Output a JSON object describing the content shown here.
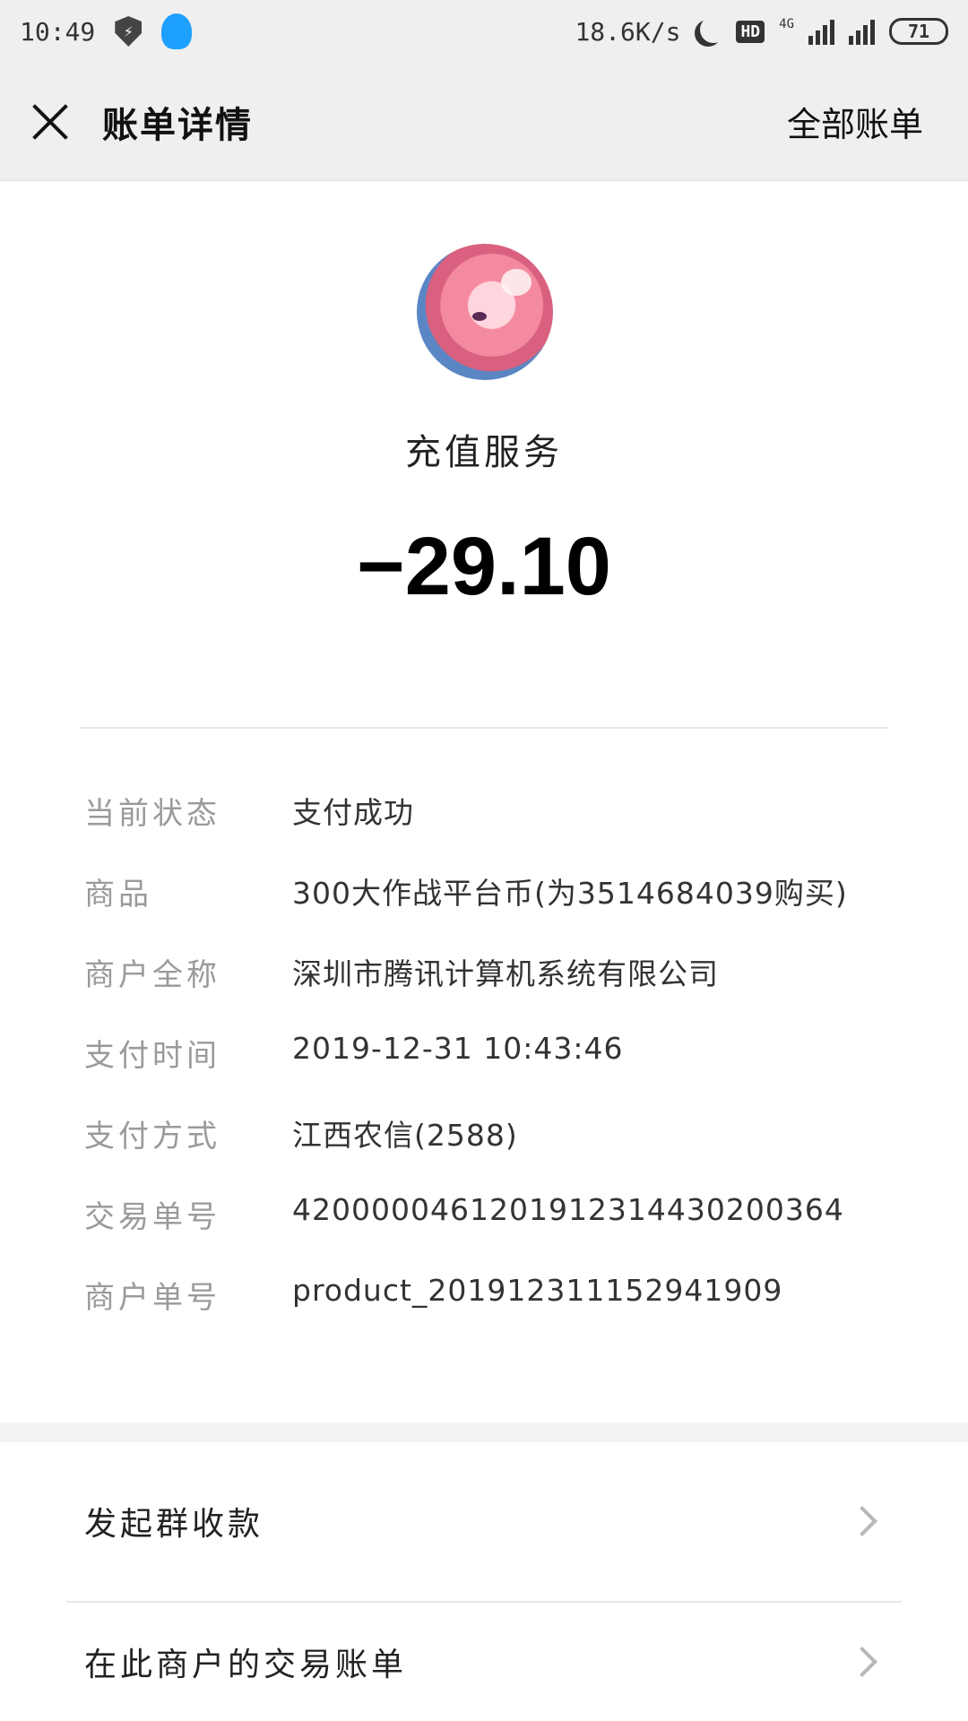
{
  "status_bar": {
    "time": "10:49",
    "network_speed": "18.6K/s",
    "hd_label": "HD",
    "network_type": "4G",
    "battery": "71",
    "icons": [
      "shield-icon",
      "qq-penguin-icon",
      "moon-icon",
      "signal-icon",
      "battery-icon"
    ]
  },
  "header": {
    "title": "账单详情",
    "all_bills_label": "全部账单",
    "close_icon": "close-icon"
  },
  "summary": {
    "merchant_name": "充值服务",
    "amount": "−29.10"
  },
  "details": [
    {
      "label": "当前状态",
      "value": "支付成功"
    },
    {
      "label": "商品",
      "value": "300大作战平台币(为3514684039购买)"
    },
    {
      "label": "商户全称",
      "value": "深圳市腾讯计算机系统有限公司"
    },
    {
      "label": "支付时间",
      "value": "2019-12-31 10:43:46"
    },
    {
      "label": "支付方式",
      "value": "江西农信(2588)"
    },
    {
      "label": "交易单号",
      "value": "4200000461201912314430200364"
    },
    {
      "label": "商户单号",
      "value": "product_201912311152941909"
    }
  ],
  "actions": [
    {
      "label": "发起群收款"
    },
    {
      "label": "在此商户的交易账单"
    }
  ],
  "colors": {
    "bar_background": "#efefef",
    "label_gray": "#9a9a9a",
    "chevron_gray": "#b8b8b8",
    "qq_blue": "#1ea0ff"
  }
}
